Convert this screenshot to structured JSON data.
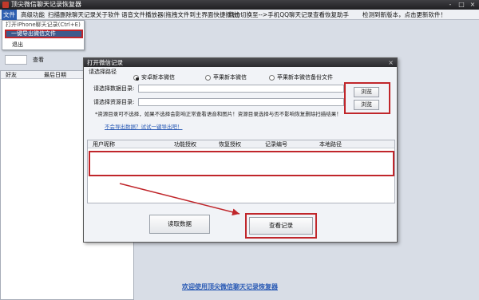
{
  "window": {
    "title": "顶尖微信聊天记录恢复器",
    "controls": [
      "-",
      "□",
      "×"
    ]
  },
  "menu": {
    "items": [
      "文件",
      "高级功能",
      "扫描删除聊天记录",
      "关于软件",
      "语音文件播放器(拖拽文件到主界面快捷播放)",
      "点击切换至-->手机QQ聊天记录查看恢复助手",
      "检测到新版本，点击更新软件！"
    ]
  },
  "file_menu": {
    "items": [
      "打开iPhone聊天记录(Ctrl+E)",
      "一键导出微信文件",
      "退出"
    ]
  },
  "left_pane": {
    "qq_label": "查看",
    "col_friend": "好友",
    "col_last": "最后日期"
  },
  "welcome": "欢迎使用顶尖微信聊天记录恢复器",
  "dialog": {
    "title": "打开微信记录",
    "close": "×",
    "path_group_label": "请选择路径",
    "radio_options": [
      "安卓新本微信",
      "苹果新本微信",
      "苹果新本微信备份文件"
    ],
    "db_dir_label": "请选择数据目录:",
    "res_dir_label": "请选择资源目录:",
    "db_dir_value": "",
    "res_dir_value": "",
    "browse1": "浏览",
    "browse2": "浏览",
    "note": "*资源目录可不选择，如果不选择会影响正常查看语音和图片！资源目录选择与否不影响恢复删除扫描结果！",
    "help_link": "不会导出数据？试试一键导出吧！",
    "table_headers": [
      "用户昵称",
      "功能授权",
      "恢复授权",
      "记录编号",
      "本地路径"
    ],
    "read_button": "读取数据",
    "view_button": "查看记录"
  },
  "colors": {
    "highlight": "#c0262b",
    "arrow": "#c0262b",
    "link": "#2b5bb5"
  }
}
